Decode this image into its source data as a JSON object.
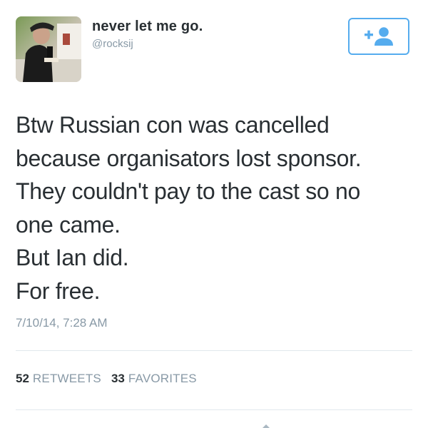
{
  "profile": {
    "display_name": "never let me go.",
    "handle": "@rocksij"
  },
  "follow_button": {
    "icon": "add-person-icon",
    "color": "#55acee"
  },
  "tweet": {
    "text_lines": [
      "Btw Russian con was cancelled",
      "because organisators lost sponsor.",
      "They couldn't pay to the cast so no",
      "one came.",
      "But Ian did.",
      "For free."
    ],
    "timestamp": "7/10/14, 7:28 AM"
  },
  "stats": {
    "retweets_count": "52",
    "retweets_label": "RETWEETS",
    "favorites_count": "33",
    "favorites_label": "FAVORITES"
  },
  "colors": {
    "text": "#292f33",
    "muted": "#8899a6",
    "accent": "#55acee",
    "divider": "#e1e8ed"
  }
}
